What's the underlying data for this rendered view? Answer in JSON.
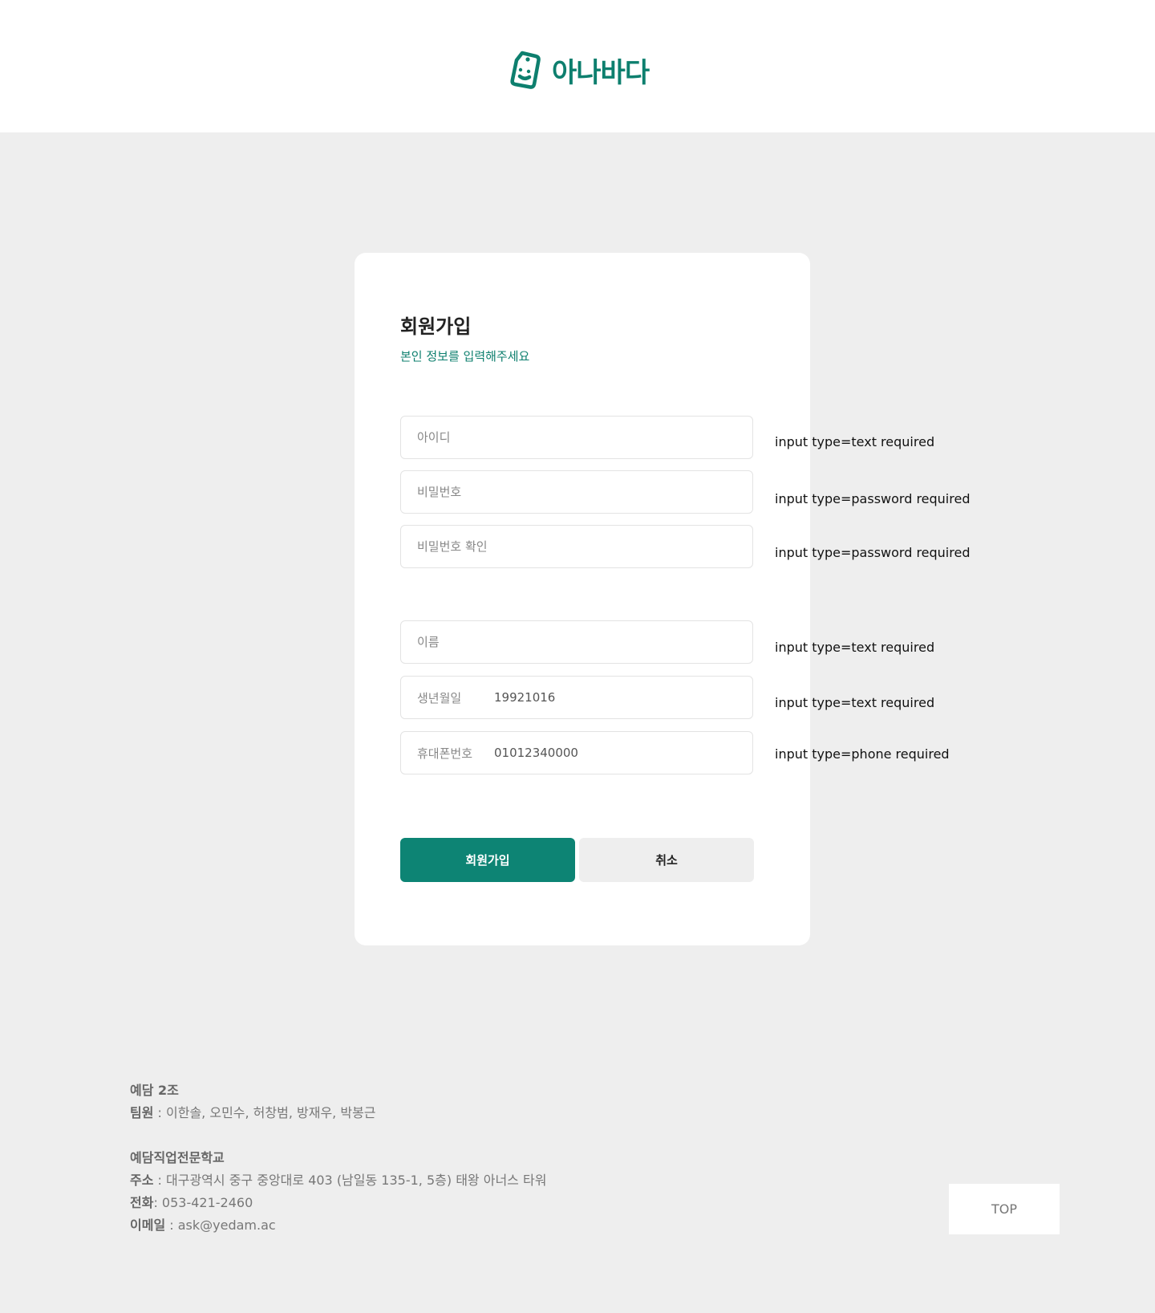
{
  "brand": {
    "name": "아나바다",
    "color": "#0d7f6e",
    "icon": "price-tag-smile-icon"
  },
  "form": {
    "title": "회원가입",
    "subtitle": "본인 정보를 입력해주세요",
    "fields": {
      "id": {
        "placeholder": "아이디",
        "note": "input type=text required"
      },
      "password": {
        "placeholder": "비밀번호",
        "note": "input type=password required"
      },
      "password_confirm": {
        "placeholder": "비밀번호 확인",
        "note": "input type=password required"
      },
      "name": {
        "placeholder": "이름",
        "note": "input type=text required"
      },
      "birth": {
        "label": "생년월일",
        "value": "19921016",
        "note": "input type=text required"
      },
      "phone": {
        "label": "휴대폰번호",
        "value": "01012340000",
        "note": "input type=phone required"
      }
    },
    "submit_label": "회원가입",
    "cancel_label": "취소",
    "accent_color": "#0d8474"
  },
  "footer": {
    "team_title": "예담 2조",
    "members_label": "팀원",
    "members": " : 이한솔, 오민수, 허창범, 방재우, 박봉근",
    "school": "예담직업전문학교",
    "address_label": "주소",
    "address": " : 대구광역시 중구 중앙대로 403 (남일동 135-1, 5층) 태왕 아너스 타워",
    "phone_label": "전화",
    "phone": ": 053-421-2460",
    "email_label": "이메일",
    "email": " : ask@yedam.ac"
  },
  "top_button": "TOP"
}
